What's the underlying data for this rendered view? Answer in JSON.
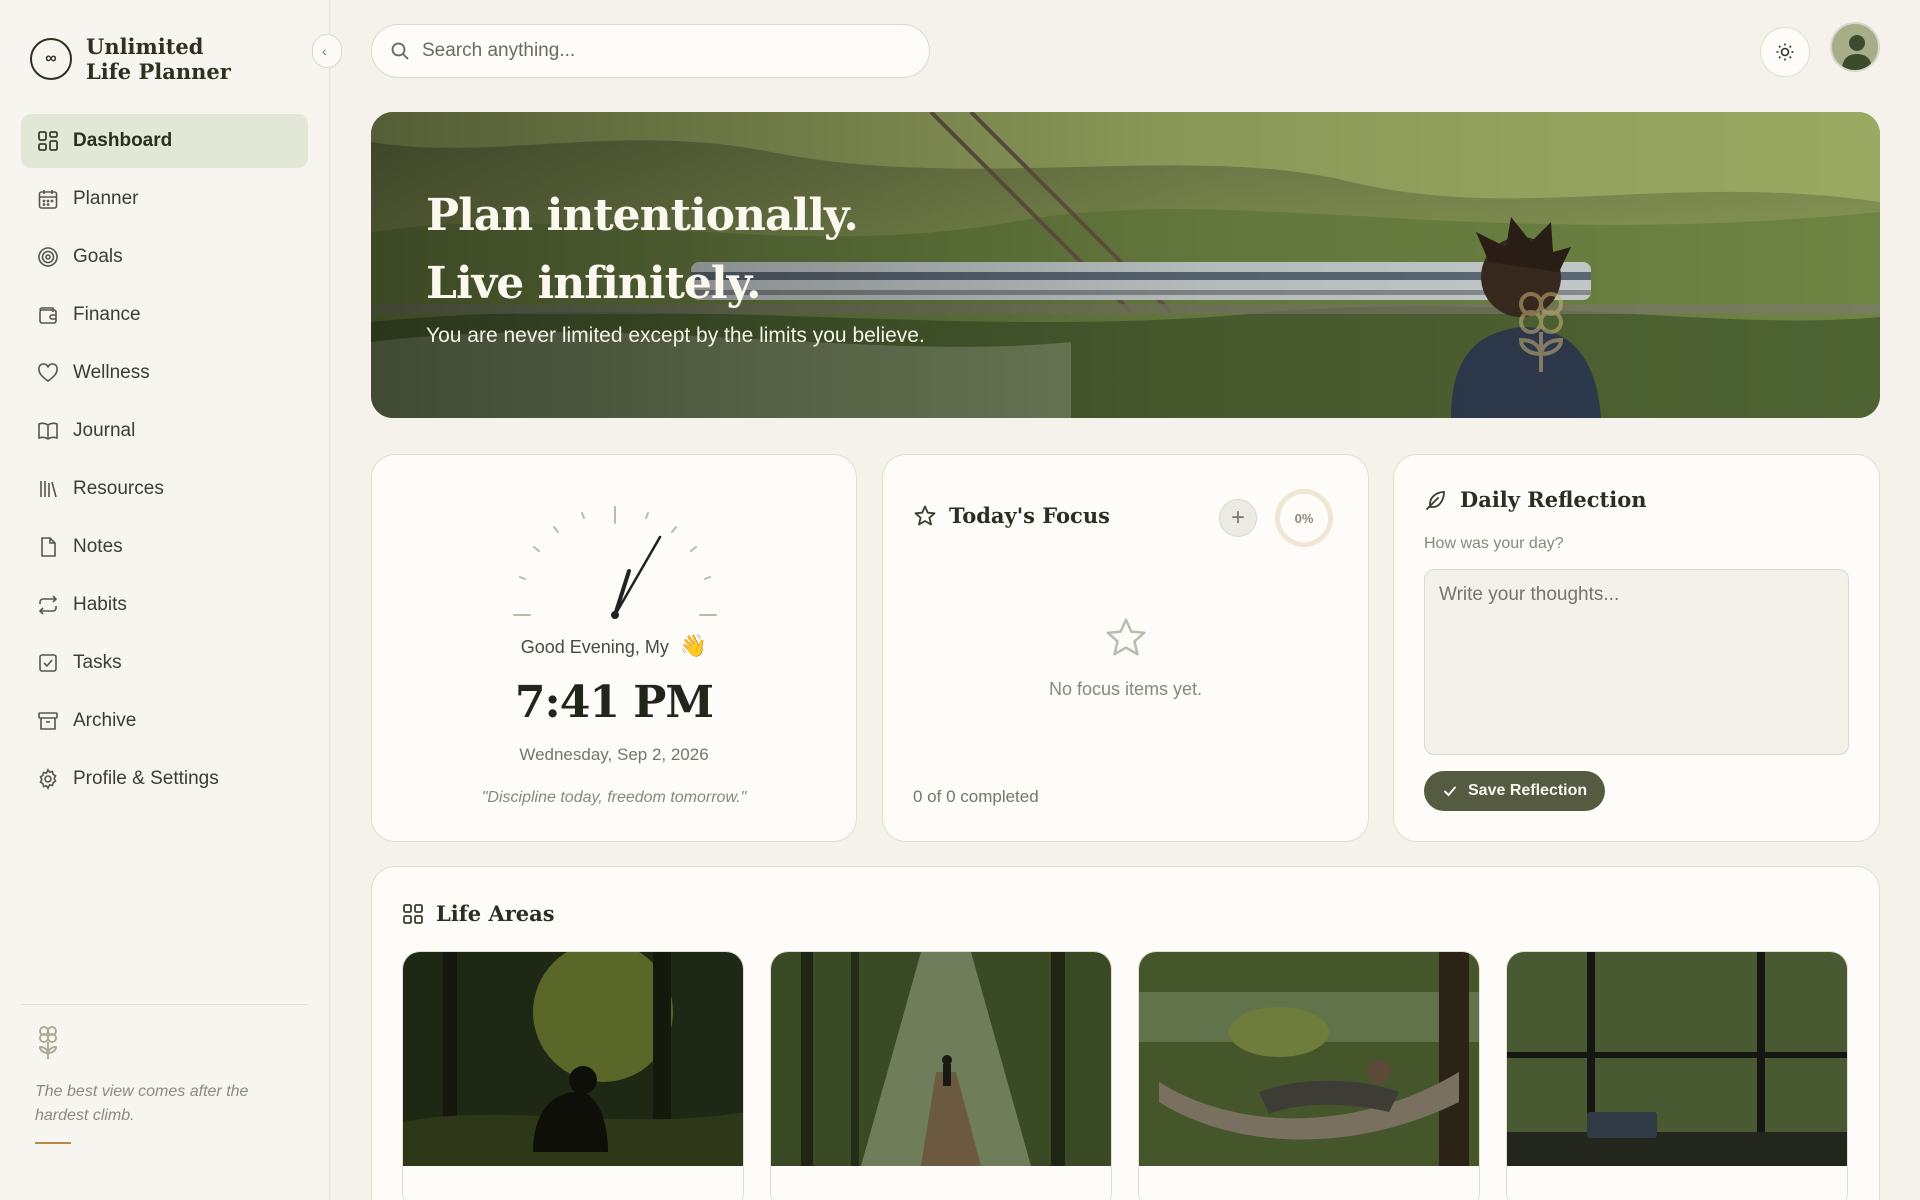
{
  "app": {
    "name_line1": "Unlimited",
    "name_line2": "Life Planner",
    "logo_symbol": "∞"
  },
  "sidebar": {
    "items": [
      {
        "label": "Dashboard",
        "icon": "dashboard-grid-icon",
        "active": true
      },
      {
        "label": "Planner",
        "icon": "calendar-icon"
      },
      {
        "label": "Goals",
        "icon": "target-icon"
      },
      {
        "label": "Finance",
        "icon": "wallet-icon"
      },
      {
        "label": "Wellness",
        "icon": "heart-icon"
      },
      {
        "label": "Journal",
        "icon": "book-open-icon"
      },
      {
        "label": "Resources",
        "icon": "library-icon"
      },
      {
        "label": "Notes",
        "icon": "file-icon"
      },
      {
        "label": "Habits",
        "icon": "repeat-icon"
      },
      {
        "label": "Tasks",
        "icon": "checkbox-icon"
      },
      {
        "label": "Archive",
        "icon": "archive-icon"
      },
      {
        "label": "Profile & Settings",
        "icon": "gear-icon"
      }
    ],
    "footer_quote": "The best view comes after the hardest climb."
  },
  "topbar": {
    "search_placeholder": "Search anything..."
  },
  "hero": {
    "title_line1": "Plan intentionally.",
    "title_line2": "Live infinitely.",
    "subtitle": "You are never limited except by the limits you believe."
  },
  "clock": {
    "greeting": "Good Evening, My",
    "greeting_emoji": "👋",
    "time": "7:41 PM",
    "date": "Wednesday, Sep 2, 2026",
    "motto": "\"Discipline today, freedom tomorrow.\""
  },
  "focus": {
    "title": "Today's Focus",
    "add_label": "+",
    "progress": "0%",
    "empty_text": "No focus items yet.",
    "completed_text": "0 of 0 completed"
  },
  "reflection": {
    "title": "Daily Reflection",
    "question": "How was your day?",
    "placeholder": "Write your thoughts...",
    "save_label": "Save Reflection"
  },
  "life_areas": {
    "title": "Life Areas"
  },
  "colors": {
    "accent": "#555b40",
    "active_nav": "#e3e7d8",
    "background": "#f5f2eb"
  }
}
